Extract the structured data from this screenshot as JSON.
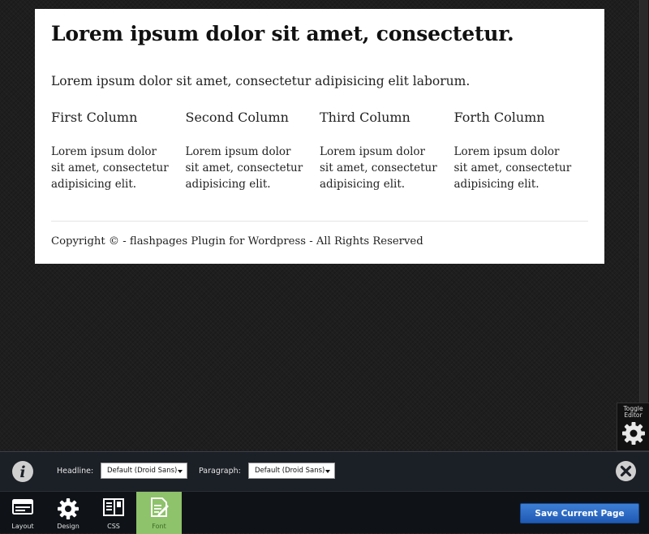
{
  "page": {
    "heading": "Lorem ipsum dolor sit amet, consectetur.",
    "intro": "Lorem ipsum dolor sit amet, consectetur adipisicing elit laborum.",
    "columns": [
      {
        "title": "First Column",
        "text": "Lorem ipsum dolor sit amet, consectetur adipisicing elit."
      },
      {
        "title": "Second Column",
        "text": "Lorem ipsum dolor sit amet, consectetur adipisicing elit."
      },
      {
        "title": "Third Column",
        "text": "Lorem ipsum dolor sit amet, consectetur adipisicing elit."
      },
      {
        "title": "Forth Column",
        "text": "Lorem ipsum dolor sit amet, consectetur adipisicing elit."
      }
    ],
    "footer": "Copyright © - flashpages Plugin for Wordpress - All Rights Reserved"
  },
  "toggle": {
    "label": "Toggle Editor",
    "icon": "gear-icon"
  },
  "font_panel": {
    "info_icon": "info-icon",
    "headline_label": "Headline:",
    "headline_value": "Default (Droid Sans)",
    "paragraph_label": "Paragraph:",
    "paragraph_value": "Default (Droid Sans)",
    "close_icon": "close-icon"
  },
  "toolbar": {
    "tools": [
      {
        "label": "Layout",
        "icon": "layout-icon",
        "active": false
      },
      {
        "label": "Design",
        "icon": "gear-icon",
        "active": false
      },
      {
        "label": "CSS",
        "icon": "css-icon",
        "active": false
      },
      {
        "label": "Font",
        "icon": "font-icon",
        "active": true
      }
    ],
    "save_label": "Save Current Page"
  },
  "colors": {
    "accent_active": "#8ec26b",
    "save_button": "#2a68c4",
    "panel": "#1b1f26"
  }
}
